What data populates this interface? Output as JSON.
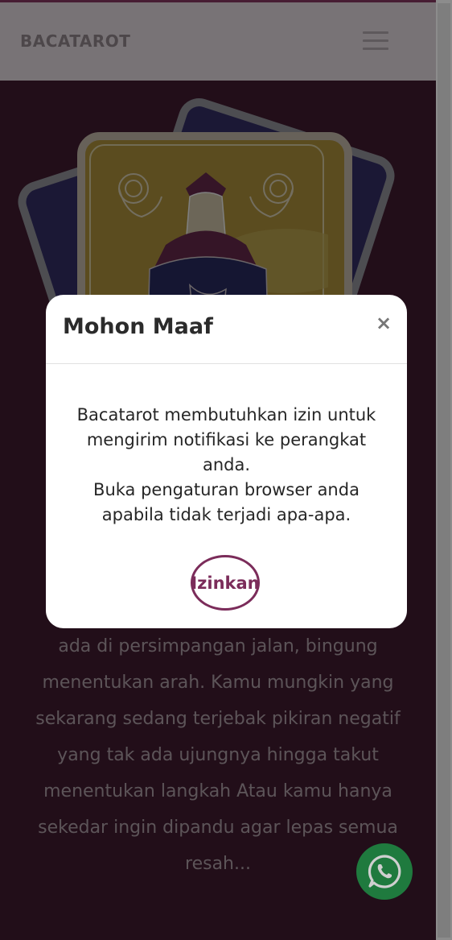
{
  "navbar": {
    "brand": "BACATAROT",
    "menu_icon": "hamburger-menu-icon"
  },
  "hero": {
    "card_image": "tarot-card-emperor"
  },
  "body_text": {
    "lines": [
      "ada di persimpangan jalan, bingung",
      "menentukan arah. Kamu mungkin yang",
      "sekarang sedang terjebak pikiran negatif",
      "yang tak ada ujungnya hingga takut",
      "menentukan langkah Atau kamu hanya",
      "sekedar ingin dipandu agar lepas semua",
      "resah..."
    ]
  },
  "modal": {
    "title": "Mohon Maaf",
    "close_label": "×",
    "message_lines": [
      "Bacatarot membutuhkan izin untuk",
      "mengirim notifikasi ke perangkat",
      "anda.",
      "Buka pengaturan browser anda",
      "apabila tidak terjadi apa-apa."
    ],
    "allow_button": "Izinkan"
  },
  "whatsapp": {
    "icon": "whatsapp-icon"
  },
  "colors": {
    "brand_purple": "#7b2c5a",
    "background": "#451c33",
    "whatsapp_green": "#25d366"
  }
}
